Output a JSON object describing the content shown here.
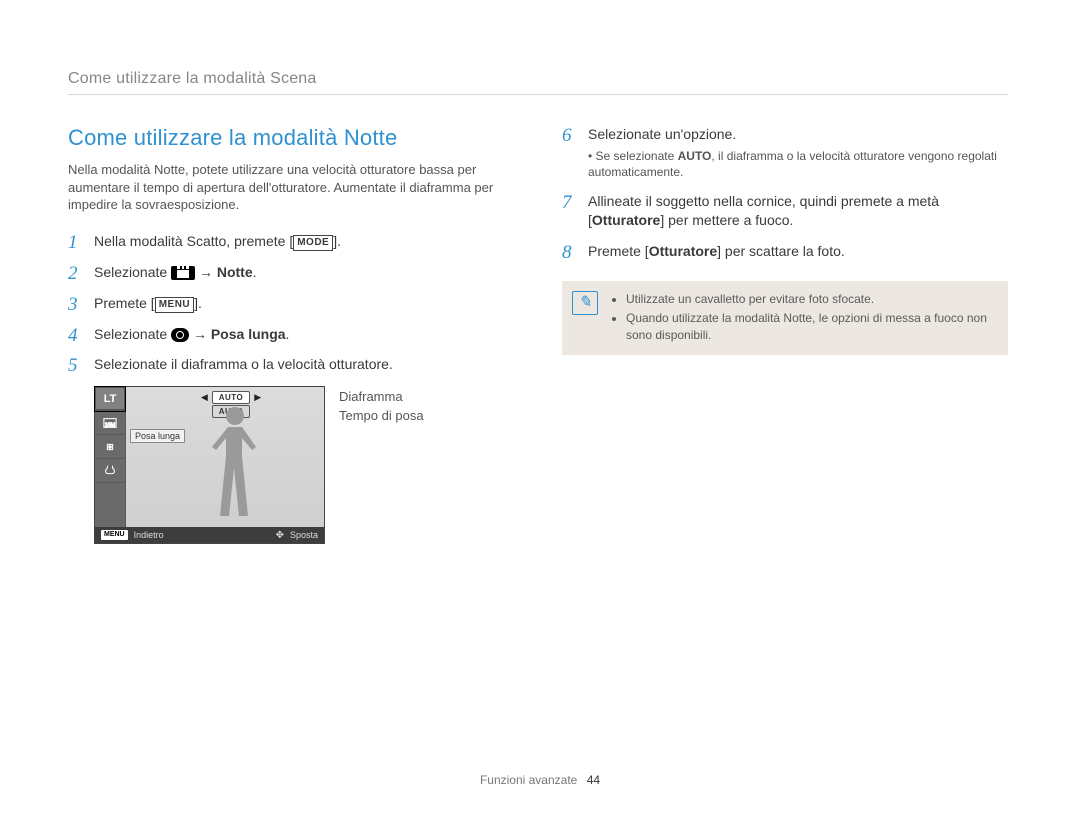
{
  "sectionHeader": "Come utilizzare la modalità Scena",
  "title": "Come utilizzare la modalità Notte",
  "intro": "Nella modalità Notte, potete utilizzare una velocità otturatore bassa per aumentare il tempo di apertura dell'otturatore. Aumentate il diaframma per impedire la sovraesposizione.",
  "icons": {
    "mode": "MODE",
    "menu": "MENU",
    "scn": "SCN"
  },
  "stepsLeft": {
    "s1a": "Nella modalità Scatto, premete [",
    "s1b": "].",
    "s2a": "Selezionate ",
    "s2b": " → ",
    "s2bold": "Notte",
    "s2c": ".",
    "s3a": "Premete [",
    "s3b": "].",
    "s4a": "Selezionate ",
    "s4b": " → ",
    "s4bold": "Posa lunga",
    "s4c": ".",
    "s5": "Selezionate il diaframma o la velocità otturatore."
  },
  "lcd": {
    "lt": "LT",
    "auto": "AUTO",
    "posalunga": "Posa lunga",
    "indietro": "Indietro",
    "sposta": "Sposta",
    "menu": "MENU",
    "calloutDiaframma": "Diaframma",
    "calloutTempo": "Tempo di posa"
  },
  "stepsRight": {
    "s6": "Selezionate un'opzione.",
    "s6suba": "Se selezionate ",
    "s6bold": "AUTO",
    "s6subb": ", il diaframma o la velocità otturatore vengono regolati automaticamente.",
    "s7a": "Allineate il soggetto nella cornice, quindi premete a metà [",
    "s7bold": "Otturatore",
    "s7b": "] per mettere a fuoco.",
    "s8a": "Premete [",
    "s8bold": "Otturatore",
    "s8b": "] per scattare la foto."
  },
  "note": {
    "n1": "Utilizzate un cavalletto per evitare foto sfocate.",
    "n2": "Quando utilizzate la modalità Notte, le opzioni di messa a fuoco non sono disponibili."
  },
  "footerText": "Funzioni avanzate",
  "footerPage": "44"
}
